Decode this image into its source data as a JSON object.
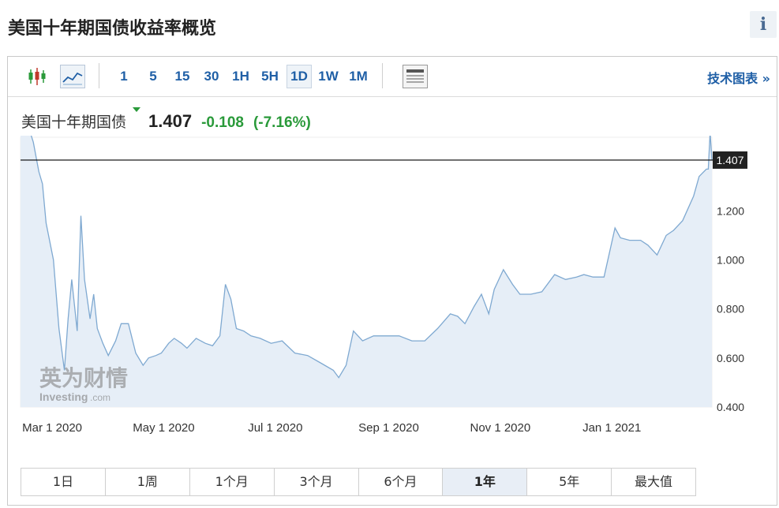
{
  "page": {
    "title": "美国十年期国债收益率概览",
    "info_icon": "i"
  },
  "toolbar": {
    "timeframes": [
      "1",
      "5",
      "15",
      "30",
      "1H",
      "5H",
      "1D",
      "1W",
      "1M"
    ],
    "active_timeframe": "1D",
    "tech_chart_label": "技术图表 »",
    "icons": [
      "candlestick-icon",
      "line-chart-icon",
      "table-view-icon"
    ]
  },
  "quote": {
    "name": "美国十年期国债",
    "price": "1.407",
    "change": "-0.108",
    "change_pct": "(-7.16%)",
    "direction_color": "#2a9a3a"
  },
  "watermark": {
    "cn": "英为财情",
    "en": "Investing",
    "suffix": ".com"
  },
  "range_buttons": [
    "1日",
    "1周",
    "1个月",
    "3个月",
    "6个月",
    "1年",
    "5年",
    "最大值"
  ],
  "active_range": "1年",
  "colors": {
    "line": "#7fa9d1",
    "area": "#e6eef7",
    "current_line": "#000000",
    "label_bg": "#222222"
  },
  "chart_data": {
    "type": "area",
    "x_tick_labels": [
      "Mar 1 2020",
      "May 1 2020",
      "Jul 1 2020",
      "Sep 1 2020",
      "Nov 1 2020",
      "Jan 1 2021"
    ],
    "x_tick_dates": [
      "2020-03-01",
      "2020-05-01",
      "2020-07-01",
      "2020-09-01",
      "2020-11-01",
      "2021-01-01"
    ],
    "x_range": [
      "2020-02-14",
      "2021-02-26"
    ],
    "y_tick_labels": [
      "0.400",
      "0.600",
      "0.800",
      "1.000",
      "1.200"
    ],
    "y_ticks": [
      0.4,
      0.6,
      0.8,
      1.0,
      1.2
    ],
    "ylim": [
      0.4,
      1.5
    ],
    "current_value": 1.407,
    "current_label": "1.407",
    "series": [
      {
        "dates": [
          "2020-02-14",
          "2020-02-18",
          "2020-02-21",
          "2020-02-24",
          "2020-02-26",
          "2020-02-28",
          "2020-03-03",
          "2020-03-06",
          "2020-03-09",
          "2020-03-11",
          "2020-03-13",
          "2020-03-16",
          "2020-03-18",
          "2020-03-20",
          "2020-03-23",
          "2020-03-25",
          "2020-03-27",
          "2020-03-30",
          "2020-04-02",
          "2020-04-06",
          "2020-04-09",
          "2020-04-13",
          "2020-04-17",
          "2020-04-21",
          "2020-04-24",
          "2020-04-28",
          "2020-05-01",
          "2020-05-05",
          "2020-05-08",
          "2020-05-12",
          "2020-05-15",
          "2020-05-20",
          "2020-05-25",
          "2020-05-29",
          "2020-06-02",
          "2020-06-05",
          "2020-06-08",
          "2020-06-11",
          "2020-06-15",
          "2020-06-19",
          "2020-06-24",
          "2020-06-30",
          "2020-07-06",
          "2020-07-13",
          "2020-07-20",
          "2020-07-27",
          "2020-08-03",
          "2020-08-06",
          "2020-08-10",
          "2020-08-14",
          "2020-08-19",
          "2020-08-25",
          "2020-08-31",
          "2020-09-08",
          "2020-09-15",
          "2020-09-22",
          "2020-09-29",
          "2020-10-06",
          "2020-10-10",
          "2020-10-14",
          "2020-10-19",
          "2020-10-23",
          "2020-10-27",
          "2020-10-30",
          "2020-11-04",
          "2020-11-09",
          "2020-11-13",
          "2020-11-19",
          "2020-11-25",
          "2020-12-02",
          "2020-12-08",
          "2020-12-14",
          "2020-12-18",
          "2020-12-23",
          "2020-12-29",
          "2021-01-04",
          "2021-01-07",
          "2021-01-12",
          "2021-01-18",
          "2021-01-22",
          "2021-01-27",
          "2021-02-01",
          "2021-02-05",
          "2021-02-10",
          "2021-02-16",
          "2021-02-19",
          "2021-02-23",
          "2021-02-24",
          "2021-02-25",
          "2021-02-26"
        ],
        "values": [
          1.59,
          1.55,
          1.48,
          1.36,
          1.31,
          1.15,
          1.0,
          0.72,
          0.55,
          0.76,
          0.92,
          0.71,
          1.18,
          0.92,
          0.76,
          0.86,
          0.72,
          0.66,
          0.61,
          0.67,
          0.74,
          0.74,
          0.62,
          0.57,
          0.6,
          0.61,
          0.62,
          0.66,
          0.68,
          0.66,
          0.64,
          0.68,
          0.66,
          0.65,
          0.69,
          0.9,
          0.84,
          0.72,
          0.71,
          0.69,
          0.68,
          0.66,
          0.67,
          0.62,
          0.61,
          0.58,
          0.55,
          0.52,
          0.57,
          0.71,
          0.67,
          0.69,
          0.69,
          0.69,
          0.67,
          0.67,
          0.72,
          0.78,
          0.77,
          0.74,
          0.81,
          0.86,
          0.78,
          0.88,
          0.96,
          0.9,
          0.86,
          0.86,
          0.87,
          0.94,
          0.92,
          0.93,
          0.94,
          0.93,
          0.93,
          1.13,
          1.09,
          1.08,
          1.08,
          1.06,
          1.02,
          1.1,
          1.12,
          1.16,
          1.26,
          1.34,
          1.37,
          1.37,
          1.52,
          1.407
        ]
      }
    ]
  }
}
